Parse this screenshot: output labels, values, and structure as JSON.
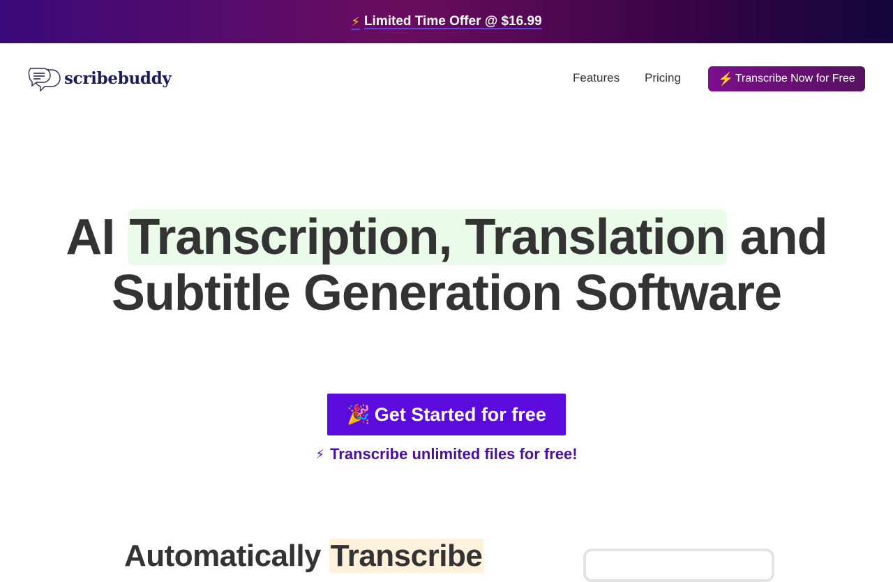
{
  "promo": {
    "icon": "lightning-icon",
    "text": "Limited Time Offer @ $16.99"
  },
  "nav": {
    "logo_text": "scribebuddy",
    "links": [
      "Features",
      "Pricing"
    ],
    "cta_label": "Transcribe Now for Free"
  },
  "hero": {
    "title_pre": "AI ",
    "title_highlight": "Transcription, Translation",
    "title_post": " and",
    "title_line2": "Subtitle Generation Software",
    "cta_label": "Get Started for free",
    "sub_text": "Transcribe unlimited files for free!"
  },
  "section2": {
    "title_pre": "Automatically ",
    "title_highlight": "Transcribe"
  },
  "colors": {
    "primary": "#5b0cdc",
    "accent": "#7b0f8a",
    "highlight_green": "#eafbe9",
    "highlight_peach": "#fff1dc"
  }
}
